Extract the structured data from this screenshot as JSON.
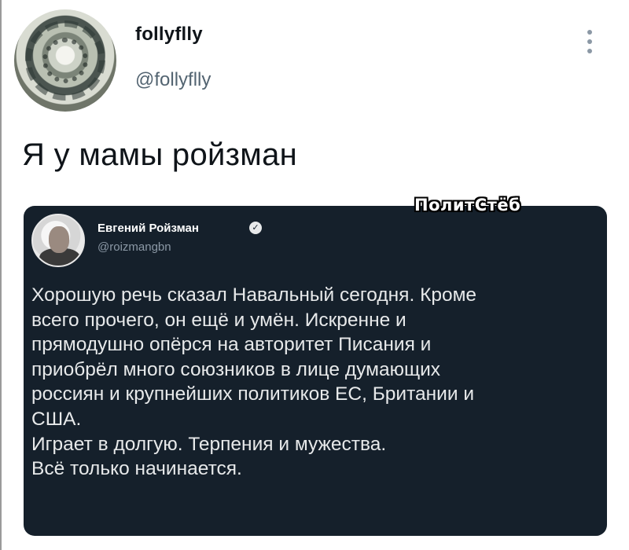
{
  "tweet": {
    "display_name": "follyflly",
    "handle": "@follyflly",
    "text": "Я у мамы ройзман",
    "more_icon": "more-vertical-icon"
  },
  "quoted_tweet": {
    "author_name": "Евгений Ройзман",
    "verified_icon": "verified-badge-icon",
    "author_handle": "@roizmangbn",
    "body": "Хорошую речь сказал Навальный сегодня. Кроме\nвсего прочего, он ещё и умён. Искренне и\nпрямодушно опёрся на авторитет Писания и\nприобрёл много союзников в лице думающих\nроссиян и крупнейших политиков ЕС, Британии и\nСША.\nИграет в долгую. Терпения и мужества.\nВсё только начинается."
  },
  "watermark": {
    "text": "ПолитСтёб"
  },
  "colors": {
    "embed_background": "#15202b",
    "embed_text": "#e7e9ea",
    "secondary_text": "#536471",
    "page_background": "#ffffff"
  }
}
